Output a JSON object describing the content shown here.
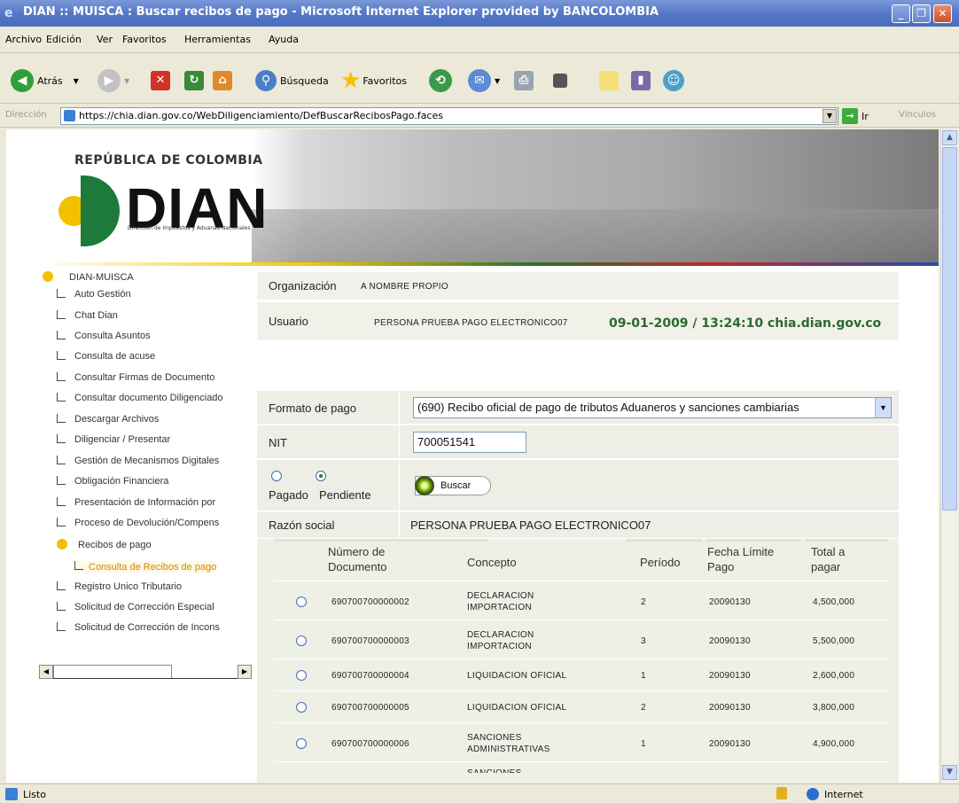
{
  "window": {
    "title": "DIAN :: MUISCA : Buscar recibos de pago - Microsoft Internet Explorer provided by BANCOLOMBIA"
  },
  "menu": [
    "Archivo",
    "Edición",
    "Ver",
    "Favoritos",
    "Herramientas",
    "Ayuda"
  ],
  "toolbar": {
    "back": "Atrás",
    "search": "Búsqueda",
    "favorites": "Favoritos"
  },
  "address": {
    "label": "Dirección",
    "url": "https://chia.dian.gov.co/WebDiligenciamiento/DefBuscarRecibosPago.faces",
    "go": "Ir",
    "links": "Vínculos"
  },
  "banner": {
    "country": "REPÚBLICA DE COLOMBIA",
    "logo": "DIAN",
    "logo_sub": "Dirección de Impuestos y Aduanas Nacionales"
  },
  "tree": {
    "root": "DIAN-MUISCA",
    "items": [
      "Auto Gestión",
      "Chat Dian",
      "Consulta Asuntos",
      "Consulta de acuse",
      "Consultar Firmas de Documento",
      "Consultar documento Diligenciado",
      "Descargar Archivos",
      "Diligenciar / Presentar",
      "Gestión de Mecanismos Digitales",
      "Obligación Financiera",
      "Presentación de Información por",
      "Proceso de Devolución/Compens"
    ],
    "recibos": "Recibos de pago",
    "consulta": "Consulta de Recibos de pago",
    "items_after": [
      "Registro Unico Tributario",
      "Solicitud de Corrección Especial",
      "Solicitud de Corrección de Incons"
    ]
  },
  "info": {
    "org_label": "Organización",
    "org_value": "A NOMBRE PROPIO",
    "user_label": "Usuario",
    "user_value": "PERSONA PRUEBA PAGO ELECTRONICO07",
    "datetime": "09-01-2009 / 13:24:10 chia.dian.gov.co"
  },
  "form": {
    "formato_label": "Formato de pago",
    "formato_value": "(690) Recibo oficial de pago de tributos Aduaneros y sanciones cambiarias",
    "nit_label": "NIT",
    "nit_value": "700051541",
    "radio_pagado": "Pagado",
    "radio_pendiente": "Pendiente",
    "buscar": "Buscar",
    "razon_label": "Razón social",
    "razon_value": "PERSONA PRUEBA PAGO ELECTRONICO07"
  },
  "table": {
    "headers": [
      "Número de\nDocumento",
      "Concepto",
      "Período",
      "Fecha Límite\nPago",
      "Total a\npagar"
    ],
    "rows": [
      {
        "doc": "690700700000002",
        "concepto": "DECLARACION IMPORTACION",
        "periodo": "2",
        "fecha": "20090130",
        "total": "4,500,000"
      },
      {
        "doc": "690700700000003",
        "concepto": "DECLARACION IMPORTACION",
        "periodo": "3",
        "fecha": "20090130",
        "total": "5,500,000"
      },
      {
        "doc": "690700700000004",
        "concepto": "LIQUIDACION OFICIAL",
        "periodo": "1",
        "fecha": "20090130",
        "total": "2,600,000"
      },
      {
        "doc": "690700700000005",
        "concepto": "LIQUIDACION OFICIAL",
        "periodo": "2",
        "fecha": "20090130",
        "total": "3,800,000"
      },
      {
        "doc": "690700700000006",
        "concepto": "SANCIONES ADMINISTRATIVAS",
        "periodo": "1",
        "fecha": "20090130",
        "total": "4,900,000"
      },
      {
        "doc": "",
        "concepto": "SANCIONES",
        "periodo": "",
        "fecha": "",
        "total": ""
      }
    ]
  },
  "status": {
    "left": "Listo",
    "zone": "Internet"
  }
}
